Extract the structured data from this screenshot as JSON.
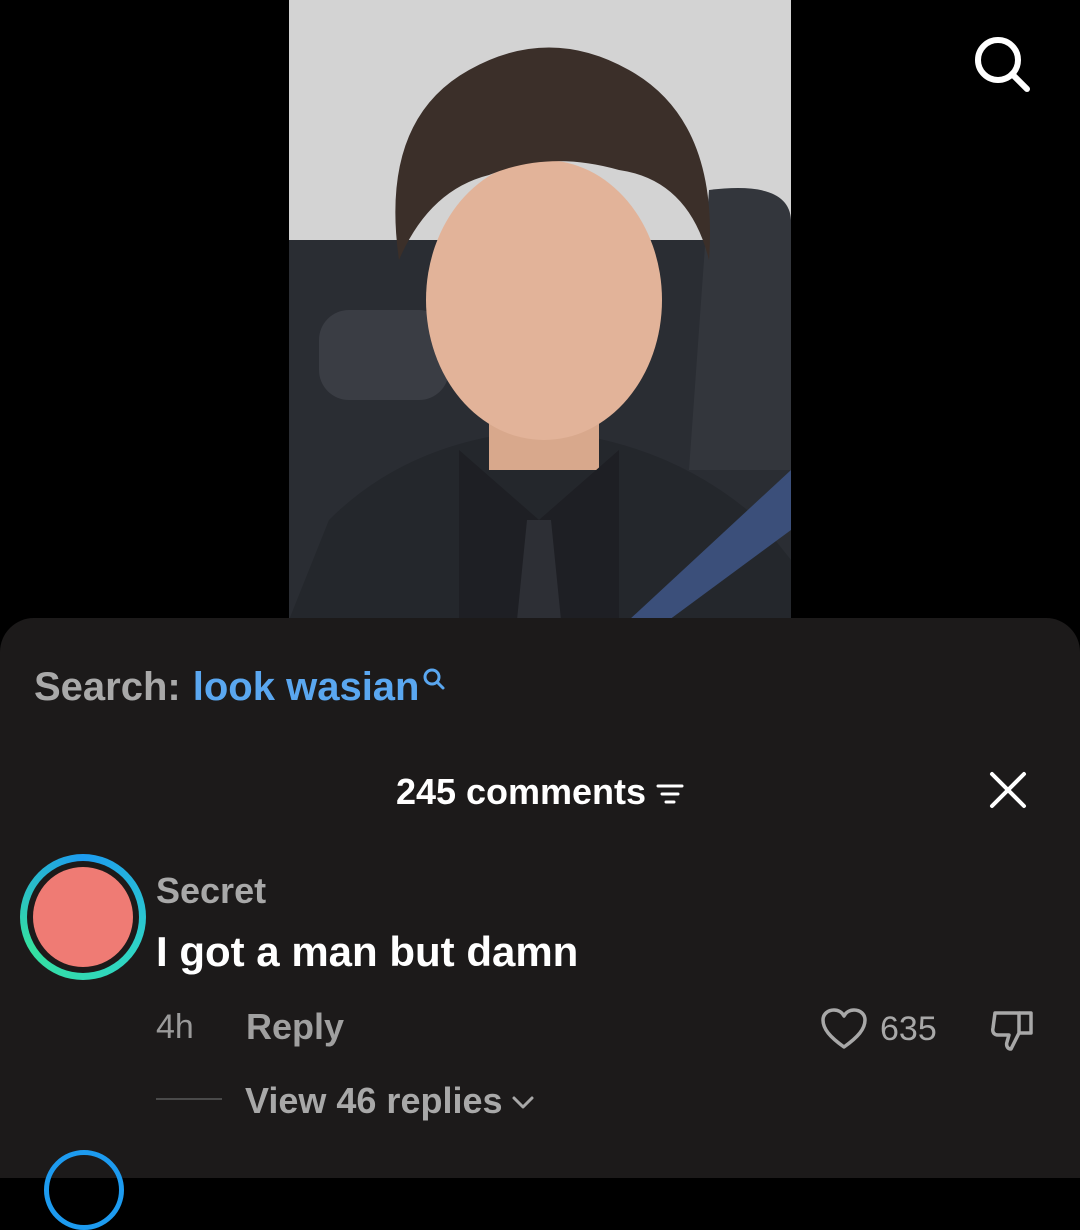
{
  "search_bar": {
    "prefix": "Search:",
    "term": "look wasian"
  },
  "comments": {
    "count_label": "245 comments",
    "items": [
      {
        "username": "Secret",
        "text": "I got a man but damn",
        "time": "4h",
        "reply_label": "Reply",
        "likes": "635",
        "view_replies_label": "View 46 replies"
      }
    ]
  },
  "colors": {
    "accent_link": "#5aa7f0",
    "sheet_bg": "#1c1a1a",
    "avatar_fill": "#ef7b74",
    "avatar_ring": "#1d9bf0"
  },
  "icons": [
    "search-icon",
    "sort-icon",
    "close-icon",
    "heart-icon",
    "dislike-icon",
    "chevron-down-icon"
  ]
}
